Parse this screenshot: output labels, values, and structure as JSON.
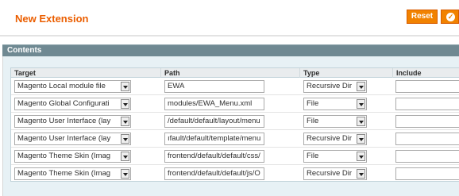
{
  "header": {
    "title": "New Extension",
    "reset_label": "Reset",
    "save_icon": "check-icon"
  },
  "panel": {
    "title": "Contents"
  },
  "grid": {
    "columns": [
      "Target",
      "Path",
      "Type",
      "Include"
    ],
    "rows": [
      {
        "target": "Magento Local module file",
        "path": "EWA",
        "type": "Recursive Dir",
        "include": ""
      },
      {
        "target": "Magento Global Configurati",
        "path": "modules/EWA_Menu.xml",
        "type": "File",
        "include": ""
      },
      {
        "target": "Magento User Interface (lay",
        "path": "/default/default/layout/menu",
        "type": "File",
        "include": ""
      },
      {
        "target": "Magento User Interface (lay",
        "path": "ıfault/default/template/menu",
        "type": "Recursive Dir",
        "include": ""
      },
      {
        "target": "Magento Theme Skin (Imag",
        "path": "frontend/default/default/css/",
        "type": "File",
        "include": ""
      },
      {
        "target": "Magento Theme Skin (Imag",
        "path": "frontend/default/default/js/O",
        "type": "Recursive Dir",
        "include": ""
      }
    ]
  }
}
